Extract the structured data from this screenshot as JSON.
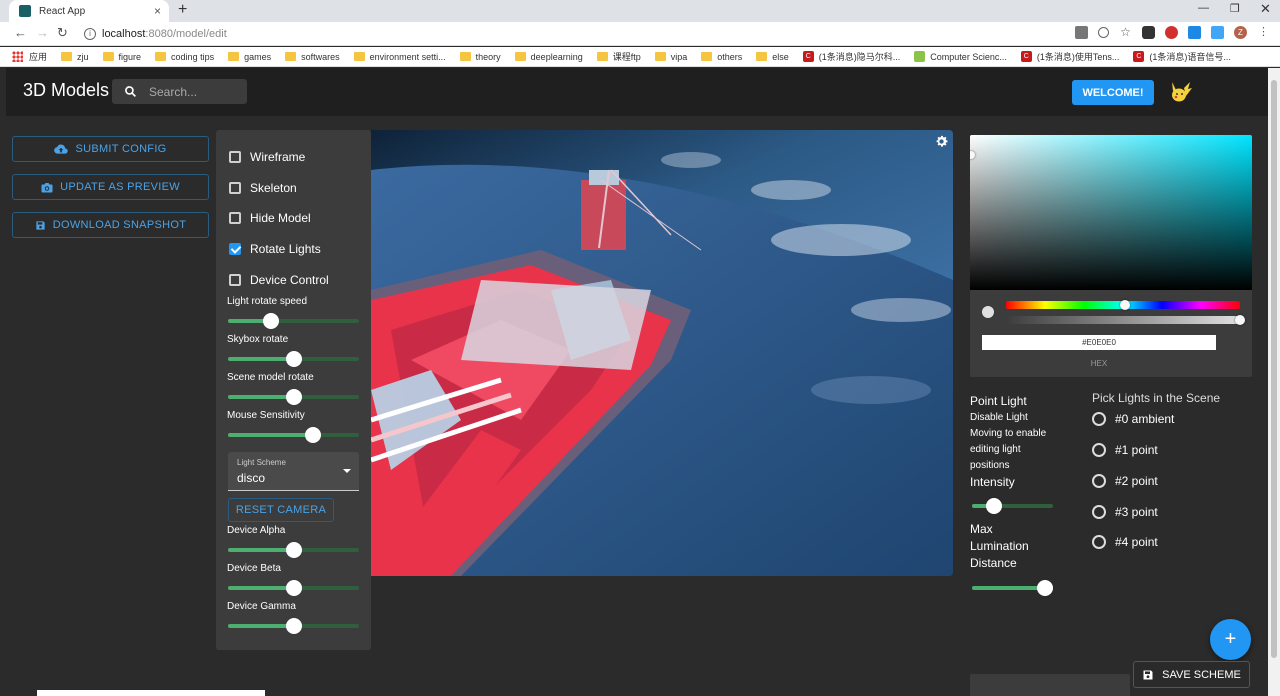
{
  "browser": {
    "tab_title": "React App",
    "url_host": "localhost",
    "url_path": ":8080/model/edit",
    "bookmarks": [
      {
        "label": "应用",
        "kind": "apps"
      },
      {
        "label": "zju",
        "kind": "folder"
      },
      {
        "label": "figure",
        "kind": "folder"
      },
      {
        "label": "coding tips",
        "kind": "folder"
      },
      {
        "label": "games",
        "kind": "folder"
      },
      {
        "label": "softwares",
        "kind": "folder"
      },
      {
        "label": "environment setti...",
        "kind": "folder"
      },
      {
        "label": "theory",
        "kind": "folder"
      },
      {
        "label": "deeplearning",
        "kind": "folder"
      },
      {
        "label": "课程ftp",
        "kind": "folder"
      },
      {
        "label": "vipa",
        "kind": "folder"
      },
      {
        "label": "others",
        "kind": "folder"
      },
      {
        "label": "else",
        "kind": "folder"
      },
      {
        "label": "(1条消息)隐马尔科...",
        "kind": "csdn"
      },
      {
        "label": "Computer Scienc...",
        "kind": "green"
      },
      {
        "label": "(1条消息)使用Tens...",
        "kind": "csdn"
      },
      {
        "label": "(1条消息)语音信号...",
        "kind": "csdn"
      }
    ],
    "avatar_letter": "Z"
  },
  "appbar": {
    "title": "3D Models",
    "search_placeholder": "Search...",
    "welcome_label": "WELCOME!"
  },
  "actions": {
    "submit_config": "SUBMIT CONFIG",
    "update_preview": "UPDATE AS PREVIEW",
    "download_snapshot": "DOWNLOAD SNAPSHOT"
  },
  "options": {
    "wireframe": "Wireframe",
    "skeleton": "Skeleton",
    "hide_model": "Hide Model",
    "rotate_lights": "Rotate Lights",
    "device_control": "Device Control",
    "wireframe_checked": false,
    "skeleton_checked": false,
    "hide_model_checked": false,
    "rotate_lights_checked": true,
    "device_control_checked": false
  },
  "sliders": {
    "light_rotate_speed": {
      "label": "Light rotate speed",
      "value": 0.33
    },
    "skybox_rotate": {
      "label": "Skybox rotate",
      "value": 0.5
    },
    "scene_model_rotate": {
      "label": "Scene model rotate",
      "value": 0.5
    },
    "mouse_sensitivity": {
      "label": "Mouse Sensitivity",
      "value": 0.65
    },
    "device_alpha": {
      "label": "Device Alpha",
      "value": 0.5
    },
    "device_beta": {
      "label": "Device Beta",
      "value": 0.5
    },
    "device_gamma": {
      "label": "Device Gamma",
      "value": 0.5
    }
  },
  "light_scheme": {
    "label": "Light Scheme",
    "value": "disco"
  },
  "reset_camera": "RESET CAMERA",
  "color_picker": {
    "hex_value": "#E0E0E0",
    "hex_label": "HEX",
    "hue_value": 0.51,
    "alpha_value": 1.0,
    "base_hue_color": "#00e5ff"
  },
  "point_light": {
    "title": "Point Light",
    "description": "Disable Light Moving to enable editing light positions",
    "intensity_label": "Intensity",
    "intensity_value": 0.27,
    "max_distance_label": "Max Lumination Distance",
    "max_distance_value": 0.9
  },
  "pick_lights": {
    "title": "Pick Lights in the Scene",
    "items": [
      "#0 ambient",
      "#1 point",
      "#2 point",
      "#3 point",
      "#4 point"
    ]
  },
  "save_scheme": "SAVE SCHEME",
  "fab_label": "+",
  "colors": {
    "accent": "#2196f3",
    "slider_fill": "#4caf70",
    "panel": "#3c3c3c",
    "background": "#2b2b2b"
  }
}
